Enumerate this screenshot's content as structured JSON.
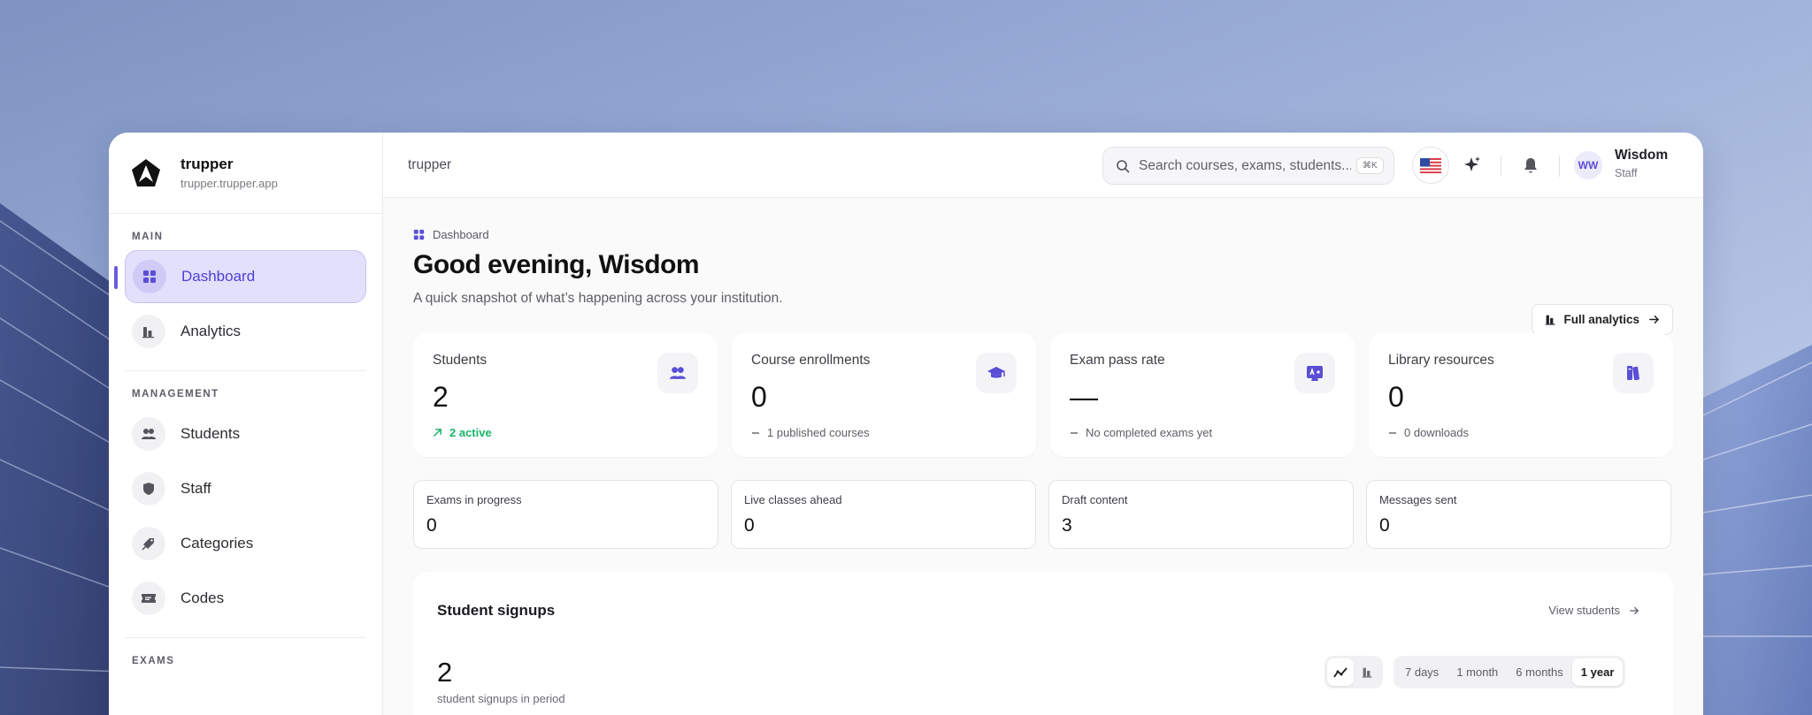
{
  "brand": {
    "name": "trupper",
    "domain": "trupper.trupper.app"
  },
  "sidebar": {
    "sections": [
      {
        "title": "MAIN",
        "items": [
          {
            "label": "Dashboard",
            "icon": "grid-icon",
            "active": true
          },
          {
            "label": "Analytics",
            "icon": "bar-chart-icon",
            "active": false
          }
        ]
      },
      {
        "title": "MANAGEMENT",
        "items": [
          {
            "label": "Students",
            "icon": "users-icon"
          },
          {
            "label": "Staff",
            "icon": "shield-icon"
          },
          {
            "label": "Categories",
            "icon": "tags-icon"
          },
          {
            "label": "Codes",
            "icon": "ticket-icon"
          }
        ]
      },
      {
        "title": "EXAMS",
        "items": []
      }
    ]
  },
  "topbar": {
    "breadcrumb": "trupper",
    "search_placeholder": "Search courses, exams, students...",
    "search_shortcut": "⌘K",
    "user": {
      "initials": "WW",
      "name": "Wisdom",
      "role": "Staff"
    }
  },
  "page": {
    "crumb": "Dashboard",
    "greeting": "Good evening, Wisdom",
    "subtitle": "A quick snapshot of what’s happening across your institution.",
    "full_analytics": "Full analytics"
  },
  "stats": [
    {
      "label": "Students",
      "value": "2",
      "foot": "2 active",
      "foot_type": "positive",
      "icon": "users-icon"
    },
    {
      "label": "Course enrollments",
      "value": "0",
      "foot": "1 published courses",
      "foot_type": "neutral",
      "icon": "graduation-cap-icon"
    },
    {
      "label": "Exam pass rate",
      "value": "—",
      "foot": "No completed exams yet",
      "foot_type": "neutral",
      "icon": "grade-icon"
    },
    {
      "label": "Library resources",
      "value": "0",
      "foot": "0 downloads",
      "foot_type": "neutral",
      "icon": "books-icon"
    }
  ],
  "mini_stats": [
    {
      "label": "Exams in progress",
      "value": "0"
    },
    {
      "label": "Live classes ahead",
      "value": "0"
    },
    {
      "label": "Draft content",
      "value": "3"
    },
    {
      "label": "Messages sent",
      "value": "0"
    }
  ],
  "signups": {
    "title": "Student signups",
    "view_link": "View students",
    "value": "2",
    "sub": "student signups in period",
    "ranges": [
      "7 days",
      "1 month",
      "6 months",
      "1 year"
    ],
    "selected_range": "1 year"
  },
  "colors": {
    "accent": "#6b5be0",
    "positive": "#1bb36a"
  }
}
